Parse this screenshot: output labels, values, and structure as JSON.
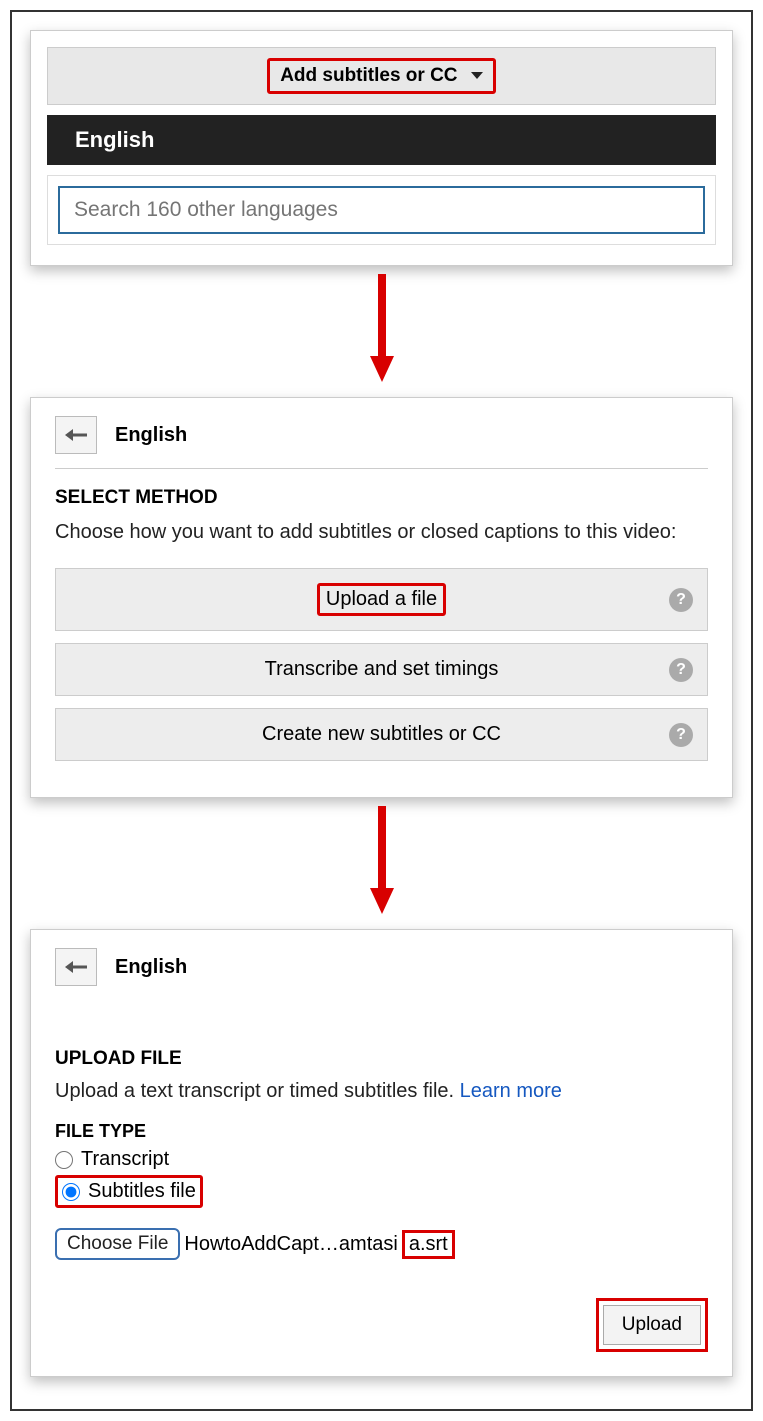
{
  "panel1": {
    "dropdown_label": "Add subtitles or CC",
    "selected_language": "English",
    "search_placeholder": "Search 160 other languages"
  },
  "panel2": {
    "language": "English",
    "section_title": "SELECT METHOD",
    "description": "Choose how you want to add subtitles or closed captions to this video:",
    "methods": {
      "upload": "Upload a file",
      "transcribe": "Transcribe and set timings",
      "create": "Create new subtitles or CC"
    }
  },
  "panel3": {
    "language": "English",
    "section_title": "UPLOAD FILE",
    "description": "Upload a text transcript or timed subtitles file. ",
    "learn_more": "Learn more",
    "file_type_title": "FILE TYPE",
    "option_transcript": "Transcript",
    "option_subtitles": "Subtitles file",
    "choose_file_label": "Choose File",
    "filename_prefix": "HowtoAddCapt…amtasi",
    "filename_ext": "a.srt",
    "upload_label": "Upload"
  }
}
